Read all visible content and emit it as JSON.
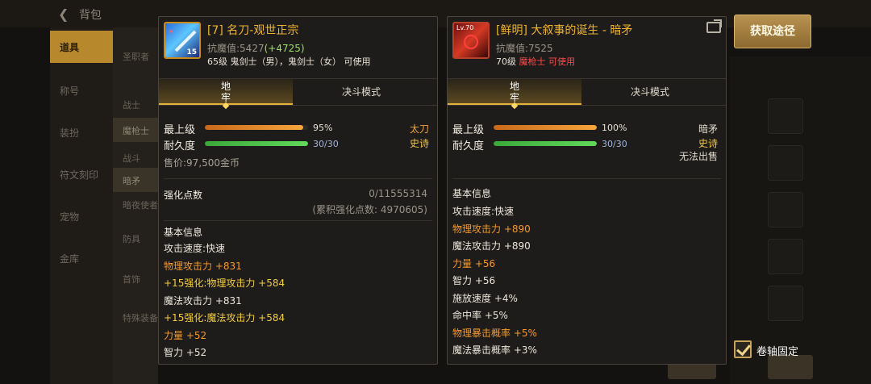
{
  "background": {
    "title": "背包",
    "sidebar": [
      "道具",
      "称号",
      "装扮",
      "符文刻印",
      "宠物",
      "金库"
    ],
    "subtabs": [
      "圣职者",
      "战士",
      "魔枪士",
      "战斗",
      "暗矛",
      "暗夜使者",
      "防具",
      "首饰",
      "特殊装备"
    ]
  },
  "left_card": {
    "icon_level": "15",
    "name": "[7] 名刀-观世正宗",
    "resist_label": "抗魔值:5427",
    "resist_plus": "(+4725)",
    "requirement": "65级 鬼剑士（男），鬼剑士（女） 可使用",
    "tabs": [
      "地牢",
      "决斗模式"
    ],
    "max_level_label": "最上级",
    "max_level_value": "95%",
    "max_level_pct": 95,
    "durability_label": "耐久度",
    "durability_value": "30/30",
    "durability_pct": 100,
    "type": "太刀",
    "rarity": "史诗",
    "price": "售价:97,500金币",
    "enhance_label": "强化点数",
    "enhance_value": "0/11555314",
    "enhance_accum": "(累积强化点数: 4970605)",
    "basic_title": "基本信息",
    "stats": [
      {
        "text": "攻击速度:快速",
        "color": "white"
      },
      {
        "text": "物理攻击力 +831",
        "color": "orange"
      },
      {
        "text": "+15强化:物理攻击力 +584",
        "color": "yellow"
      },
      {
        "text": "魔法攻击力 +831",
        "color": "white"
      },
      {
        "text": "+15强化:魔法攻击力 +584",
        "color": "yellow"
      },
      {
        "text": "力量 +52",
        "color": "orange"
      },
      {
        "text": "智力 +52",
        "color": "white"
      }
    ]
  },
  "right_card": {
    "icon_level": "Lv.70",
    "name": "[鲜明] 大叙事的诞生 - 暗矛",
    "resist_label": "抗魔值:7525",
    "requirement_prefix": "70级 ",
    "requirement_class": "魔枪士",
    "requirement_suffix": " 可使用",
    "tabs": [
      "地牢",
      "决斗模式"
    ],
    "max_level_label": "最上级",
    "max_level_value": "100%",
    "max_level_pct": 100,
    "durability_label": "耐久度",
    "durability_value": "30/30",
    "durability_pct": 100,
    "type": "暗矛",
    "rarity": "史诗",
    "sell": "无法出售",
    "basic_title": "基本信息",
    "stats": [
      {
        "text": "攻击速度:快速",
        "color": "white"
      },
      {
        "text": "物理攻击力 +890",
        "color": "orange"
      },
      {
        "text": "魔法攻击力 +890",
        "color": "white"
      },
      {
        "text": "力量 +56",
        "color": "orange"
      },
      {
        "text": "智力 +56",
        "color": "white"
      },
      {
        "text": "施放速度 +4%",
        "color": "white"
      },
      {
        "text": "命中率 +5%",
        "color": "white"
      },
      {
        "text": "物理暴击概率 +5%",
        "color": "orange"
      },
      {
        "text": "魔法暴击概率 +3%",
        "color": "white"
      }
    ]
  },
  "obtain_button": "获取途径",
  "pin_label": "卷轴固定"
}
